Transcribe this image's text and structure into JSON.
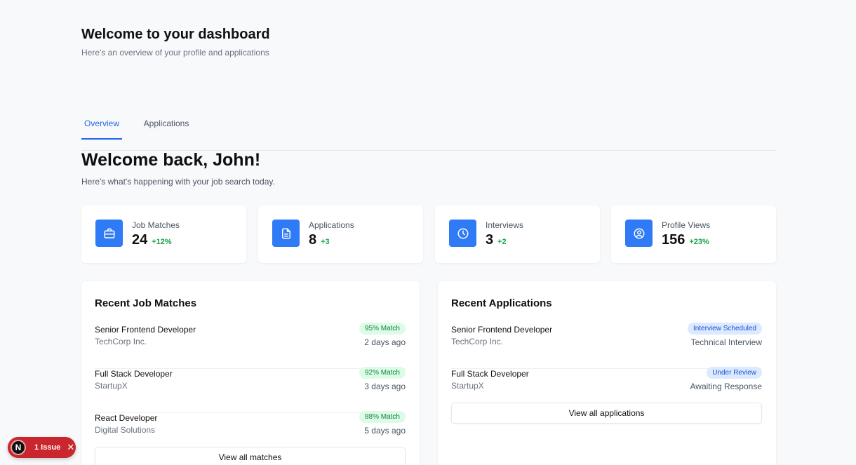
{
  "header": {
    "title": "Welcome to your dashboard",
    "subtitle": "Here's an overview of your profile and applications"
  },
  "tabs": [
    {
      "label": "Overview",
      "active": true
    },
    {
      "label": "Applications",
      "active": false
    }
  ],
  "welcome": {
    "title": "Welcome back, John!",
    "subtitle": "Here's what's happening with your job search today."
  },
  "stats": [
    {
      "label": "Job Matches",
      "value": "24",
      "change": "+12%",
      "icon": "briefcase-icon"
    },
    {
      "label": "Applications",
      "value": "8",
      "change": "+3",
      "icon": "document-icon"
    },
    {
      "label": "Interviews",
      "value": "3",
      "change": "+2",
      "icon": "clock-icon"
    },
    {
      "label": "Profile Views",
      "value": "156",
      "change": "+23%",
      "icon": "user-circle-icon"
    }
  ],
  "recent_matches": {
    "title": "Recent Job Matches",
    "items": [
      {
        "title": "Senior Frontend Developer",
        "company": "TechCorp Inc.",
        "badge": "95% Match",
        "meta": "2 days ago"
      },
      {
        "title": "Full Stack Developer",
        "company": "StartupX",
        "badge": "92% Match",
        "meta": "3 days ago"
      },
      {
        "title": "React Developer",
        "company": "Digital Solutions",
        "badge": "88% Match",
        "meta": "5 days ago"
      }
    ],
    "button": "View all matches"
  },
  "recent_applications": {
    "title": "Recent Applications",
    "items": [
      {
        "title": "Senior Frontend Developer",
        "company": "TechCorp Inc.",
        "badge": "Interview Scheduled",
        "meta": "Technical Interview"
      },
      {
        "title": "Full Stack Developer",
        "company": "StartupX",
        "badge": "Under Review",
        "meta": "Awaiting Response"
      }
    ],
    "button": "View all applications"
  },
  "issue_indicator": {
    "logo": "N",
    "label": "1 Issue",
    "close": "✕"
  },
  "colors": {
    "accent": "#2563eb",
    "icon_bg": "#2f7af5",
    "positive": "#16a34a",
    "match_badge_bg": "#dcfce7",
    "status_badge_bg": "#dbeafe",
    "issue_bg": "#c9262d"
  }
}
